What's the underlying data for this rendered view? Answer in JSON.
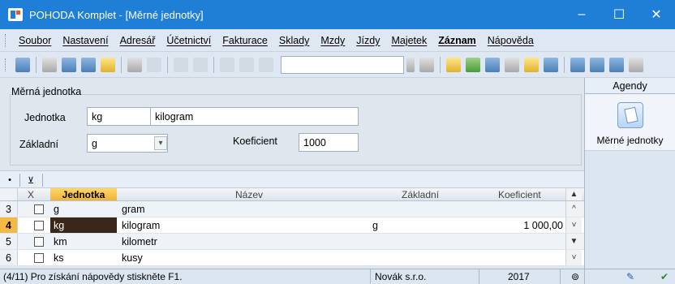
{
  "window": {
    "title": "POHODA Komplet - [Měrné jednotky]",
    "controls": [
      "–",
      "☐",
      "✕"
    ]
  },
  "menu": [
    "Soubor",
    "Nastavení",
    "Adresář",
    "Účetnictví",
    "Fakturace",
    "Sklady",
    "Mzdy",
    "Jízdy",
    "Majetek",
    "Záznam",
    "Nápověda"
  ],
  "form": {
    "section_title": "Měrná jednotka",
    "jednotka_label": "Jednotka",
    "jednotka_value": "kg",
    "nazev_value": "kilogram",
    "zakladni_label": "Základní",
    "zakladni_value": "g",
    "koeficient_label": "Koeficient",
    "koeficient_value": "1000"
  },
  "agenda": {
    "header": "Agendy",
    "item_label": "Měrné jednotky",
    "icon": "units-agenda-icon"
  },
  "table": {
    "columns": {
      "x": "X",
      "jednotka": "Jednotka",
      "nazev": "Název",
      "zakladni": "Základní",
      "koeficient": "Koeficient"
    },
    "rows": [
      {
        "num": "3",
        "code": "g",
        "name": "gram",
        "base": "",
        "coef": ""
      },
      {
        "num": "4",
        "code": "kg",
        "name": "kilogram",
        "base": "g",
        "coef": "1 000,00"
      },
      {
        "num": "5",
        "code": "km",
        "name": "kilometr",
        "base": "",
        "coef": ""
      },
      {
        "num": "6",
        "code": "ks",
        "name": "kusy",
        "base": "",
        "coef": ""
      }
    ]
  },
  "status": {
    "hint": "(4/11) Pro získání nápovědy stiskněte F1.",
    "company": "Novák s.r.o.",
    "year": "2017"
  },
  "colors": {
    "titlebar": "#1f7fd6",
    "selected_row_num": "#f4b942",
    "selected_code": "#3b2719"
  }
}
